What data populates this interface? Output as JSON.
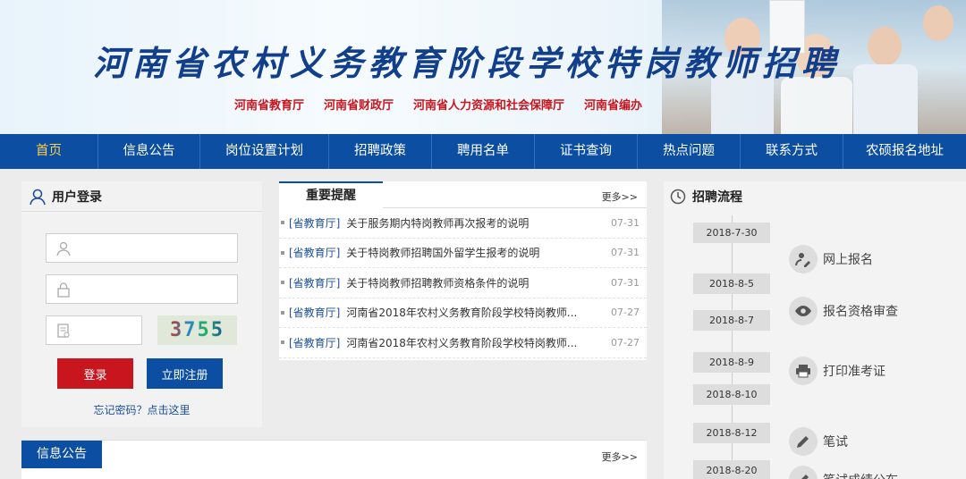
{
  "banner": {
    "title": "河南省农村义务教育阶段学校特岗教师招聘",
    "orgs": [
      "河南省教育厅",
      "河南省财政厅",
      "河南省人力资源和社会保障厅",
      "河南省编办"
    ]
  },
  "nav": {
    "items": [
      "首页",
      "信息公告",
      "岗位设置计划",
      "招聘政策",
      "聘用名单",
      "证书查询",
      "热点问题",
      "联系方式",
      "农硕报名地址"
    ]
  },
  "login": {
    "title": "用户登录",
    "captcha": "3755",
    "login_button": "登录",
    "register_button": "立即注册",
    "forgot": "忘记密码？点击这里"
  },
  "notices": {
    "tab": "重要提醒",
    "more": "更多>>",
    "items": [
      {
        "cat": "[省教育厅]",
        "title": "关于服务期内特岗教师再次报考的说明",
        "date": "07-31"
      },
      {
        "cat": "[省教育厅]",
        "title": "关于特岗教师招聘国外留学生报考的说明",
        "date": "07-31"
      },
      {
        "cat": "[省教育厅]",
        "title": "关于特岗教师招聘教师资格条件的说明",
        "date": "07-31"
      },
      {
        "cat": "[省教育厅]",
        "title": "河南省2018年农村义务教育阶段学校特岗教师...",
        "date": "07-27"
      },
      {
        "cat": "[省教育厅]",
        "title": "河南省2018年农村义务教育阶段学校特岗教师...",
        "date": "07-27"
      }
    ]
  },
  "info": {
    "tab": "信息公告",
    "more": "更多>>"
  },
  "process": {
    "title": "招聘流程",
    "dates": [
      "2018-7-30",
      "2018-8-5",
      "2018-8-7",
      "2018-8-9",
      "2018-8-10",
      "2018-8-12",
      "2018-8-20"
    ],
    "steps": [
      {
        "label": "网上报名",
        "icon": "user-edit-icon"
      },
      {
        "label": "报名资格审查",
        "icon": "eye-icon"
      },
      {
        "label": "打印准考证",
        "icon": "printer-icon"
      },
      {
        "label": "笔试",
        "icon": "pencil-icon"
      },
      {
        "label": "笔试成绩公布",
        "icon": "pencil-icon"
      }
    ]
  },
  "colors": {
    "nav": "#0b4ea2",
    "login": "#c9151e",
    "register": "#0b4ea2",
    "title": "#123f8c",
    "orgs": "#c9151e"
  }
}
